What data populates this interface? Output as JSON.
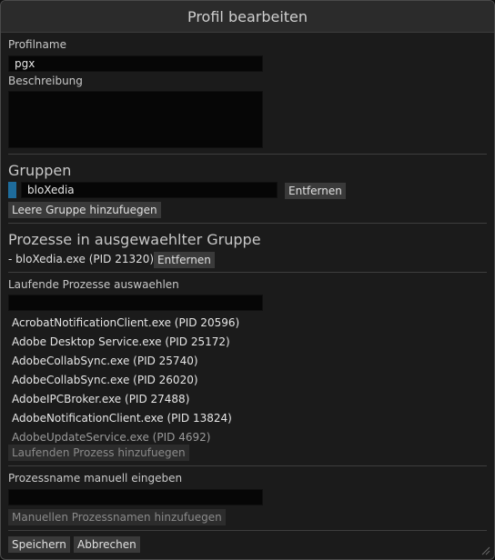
{
  "window": {
    "title": "Profil bearbeiten"
  },
  "profile": {
    "name_label": "Profilname",
    "name_value": "pgx",
    "description_label": "Beschreibung",
    "description_value": ""
  },
  "groups": {
    "heading": "Gruppen",
    "items": [
      {
        "name": "bloXedia",
        "color": "#1e6c9c",
        "remove_label": "Entfernen"
      }
    ],
    "add_empty_label": "Leere Gruppe hinzufuegen"
  },
  "group_processes": {
    "heading": "Prozesse in ausgewaehlter Gruppe",
    "items": [
      {
        "text": "- bloXedia.exe (PID 21320)",
        "remove_label": "Entfernen"
      }
    ]
  },
  "running": {
    "label": "Laufende Prozesse auswaehlen",
    "filter_value": "",
    "items": [
      "AcrobatNotificationClient.exe (PID 20596)",
      "Adobe Desktop Service.exe (PID 25172)",
      "AdobeCollabSync.exe (PID 25740)",
      "AdobeCollabSync.exe (PID 26020)",
      "AdobeIPCBroker.exe (PID 27488)",
      "AdobeNotificationClient.exe (PID 13824)",
      "AdobeUpdateService.exe (PID 4692)"
    ],
    "add_label": "Laufenden Prozess hinzufuegen"
  },
  "manual": {
    "label": "Prozessname manuell eingeben",
    "value": "",
    "add_label": "Manuellen Prozessnamen hinzufuegen"
  },
  "footer": {
    "save_label": "Speichern",
    "cancel_label": "Abbrechen"
  }
}
